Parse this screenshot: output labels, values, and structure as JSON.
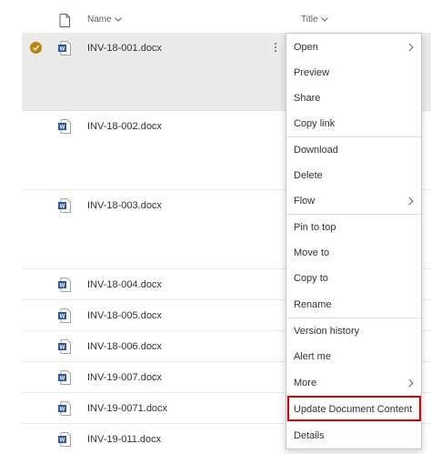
{
  "header": {
    "name_label": "Name",
    "title_label": "Title"
  },
  "files": [
    {
      "name": "INV-18-001.docx",
      "selected": true
    },
    {
      "name": "INV-18-002.docx",
      "selected": false
    },
    {
      "name": "INV-18-003.docx",
      "selected": false
    },
    {
      "name": "INV-18-004.docx",
      "selected": false
    },
    {
      "name": "INV-18-005.docx",
      "selected": false
    },
    {
      "name": "INV-18-006.docx",
      "selected": false
    },
    {
      "name": "INV-19-007.docx",
      "selected": false
    },
    {
      "name": "INV-19-0071.docx",
      "selected": false
    },
    {
      "name": "INV-19-011.docx",
      "selected": false
    }
  ],
  "menu": {
    "items": [
      {
        "label": "Open",
        "submenu": true
      },
      {
        "label": "Preview",
        "submenu": false
      },
      {
        "label": "Share",
        "submenu": false
      },
      {
        "label": "Copy link",
        "submenu": false
      },
      {
        "label": "Download",
        "submenu": false
      },
      {
        "label": "Delete",
        "submenu": false
      },
      {
        "label": "Flow",
        "submenu": true
      },
      {
        "label": "Pin to top",
        "submenu": false
      },
      {
        "label": "Move to",
        "submenu": false
      },
      {
        "label": "Copy to",
        "submenu": false
      },
      {
        "label": "Rename",
        "submenu": false
      },
      {
        "label": "Version history",
        "submenu": false
      },
      {
        "label": "Alert me",
        "submenu": false
      },
      {
        "label": "More",
        "submenu": true
      },
      {
        "label": "Update Document Content",
        "submenu": false
      },
      {
        "label": "Details",
        "submenu": false
      }
    ]
  },
  "colors": {
    "word_blue": "#2b579a",
    "selected_check": "#b8860b",
    "highlight_border": "#e00000"
  }
}
